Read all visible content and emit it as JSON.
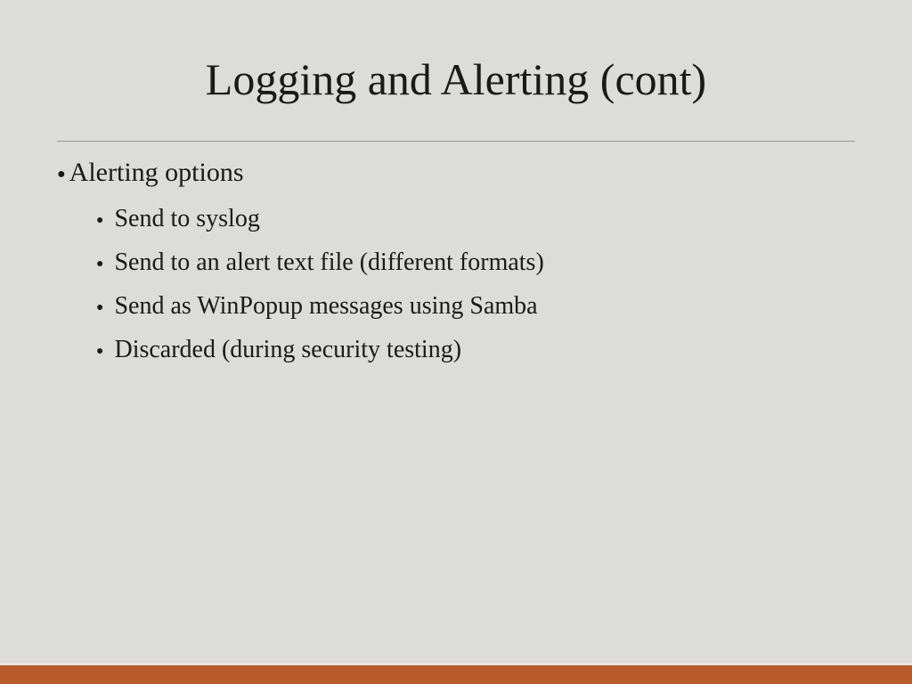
{
  "title": "Logging and Alerting (cont)",
  "bullets": {
    "main": "Alerting options",
    "sub": [
      "Send to syslog",
      "Send to an alert text file (different formats)",
      "Send as WinPopup messages using Samba",
      "Discarded (during security testing)"
    ]
  }
}
